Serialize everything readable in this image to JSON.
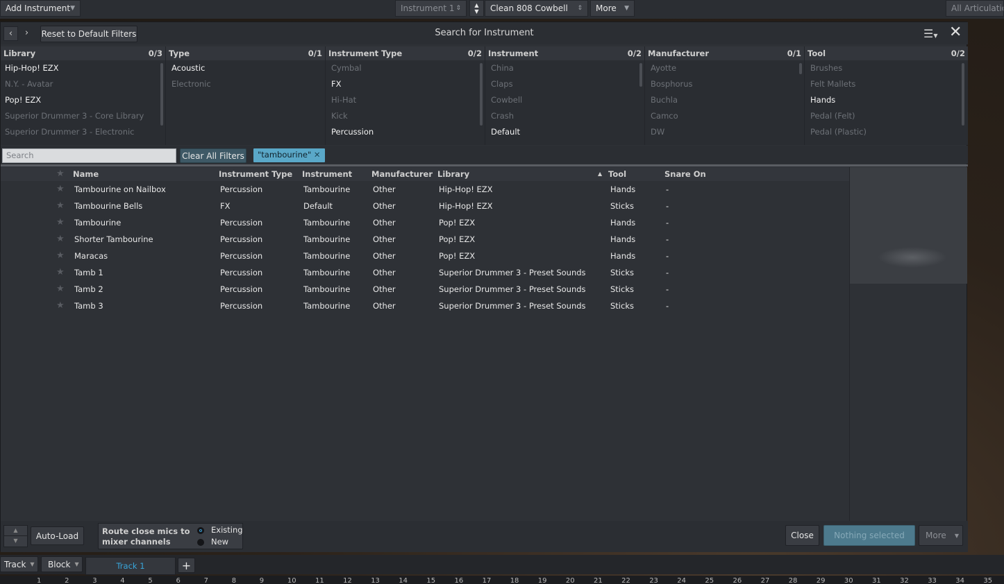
{
  "topbar": {
    "add_instrument": "Add Instrument",
    "instrument_slot": "Instrument 1",
    "preset": "Clean 808 Cowbell",
    "more": "More",
    "articulations": "All Articulations"
  },
  "dialog": {
    "title": "Search for Instrument",
    "reset_filters": "Reset to Default Filters"
  },
  "filters": {
    "library": {
      "label": "Library",
      "count": "0/3",
      "items": [
        "Hip-Hop! EZX",
        "N.Y. - Avatar",
        "Pop! EZX",
        "Superior Drummer 3 - Core Library",
        "Superior Drummer 3 - Electronic"
      ]
    },
    "type": {
      "label": "Type",
      "count": "0/1",
      "items": [
        "Acoustic",
        "Electronic"
      ]
    },
    "instrument_type": {
      "label": "Instrument Type",
      "count": "0/2",
      "items": [
        "Cymbal",
        "FX",
        "Hi-Hat",
        "Kick",
        "Percussion"
      ]
    },
    "instrument": {
      "label": "Instrument",
      "count": "0/2",
      "items": [
        "China",
        "Claps",
        "Cowbell",
        "Crash",
        "Default"
      ]
    },
    "manufacturer": {
      "label": "Manufacturer",
      "count": "0/1",
      "items": [
        "Ayotte",
        "Bosphorus",
        "Buchla",
        "Camco",
        "DW"
      ]
    },
    "tool": {
      "label": "Tool",
      "count": "0/2",
      "items": [
        "Brushes",
        "Felt Mallets",
        "Hands",
        "Pedal (Felt)",
        "Pedal (Plastic)"
      ]
    }
  },
  "search": {
    "placeholder": "Search",
    "clear_all": "Clear All Filters",
    "chip": "\"tambourine\"",
    "chip_remove": "✕"
  },
  "results": {
    "columns": [
      "Name",
      "Instrument Type",
      "Instrument",
      "Manufacturer",
      "Library",
      "Tool",
      "Snare On"
    ],
    "sort_indicator": "▲",
    "rows": [
      [
        "Tambourine on Nailbox",
        "Percussion",
        "Tambourine",
        "Other",
        "Hip-Hop! EZX",
        "Hands",
        "-"
      ],
      [
        "Tambourine Bells",
        "FX",
        "Default",
        "Other",
        "Hip-Hop! EZX",
        "Sticks",
        "-"
      ],
      [
        "Tambourine",
        "Percussion",
        "Tambourine",
        "Other",
        "Pop! EZX",
        "Hands",
        "-"
      ],
      [
        "Shorter Tambourine",
        "Percussion",
        "Tambourine",
        "Other",
        "Pop! EZX",
        "Hands",
        "-"
      ],
      [
        "Maracas",
        "Percussion",
        "Tambourine",
        "Other",
        "Pop! EZX",
        "Hands",
        "-"
      ],
      [
        "Tamb 1",
        "Percussion",
        "Tambourine",
        "Other",
        "Superior Drummer 3 - Preset Sounds",
        "Sticks",
        "-"
      ],
      [
        "Tamb 2",
        "Percussion",
        "Tambourine",
        "Other",
        "Superior Drummer 3 - Preset Sounds",
        "Sticks",
        "-"
      ],
      [
        "Tamb 3",
        "Percussion",
        "Tambourine",
        "Other",
        "Superior Drummer 3 - Preset Sounds",
        "Sticks",
        "-"
      ]
    ]
  },
  "footer": {
    "auto_load": "Auto-Load",
    "route_label_1": "Route close mics to",
    "route_label_2": "mixer channels",
    "existing": "Existing",
    "new": "New",
    "close": "Close",
    "nothing_selected": "Nothing selected",
    "more": "More"
  },
  "bottombar": {
    "track": "Track",
    "block": "Block",
    "track_tab": "Track 1",
    "add": "+"
  },
  "ruler": [
    "1",
    "2",
    "3",
    "4",
    "5",
    "6",
    "7",
    "8",
    "9",
    "10",
    "11",
    "12",
    "13",
    "14",
    "15",
    "16",
    "17",
    "18",
    "19",
    "20",
    "21",
    "22",
    "23",
    "24",
    "25",
    "26",
    "27",
    "28",
    "29",
    "30",
    "31",
    "32",
    "33",
    "34",
    "35"
  ]
}
